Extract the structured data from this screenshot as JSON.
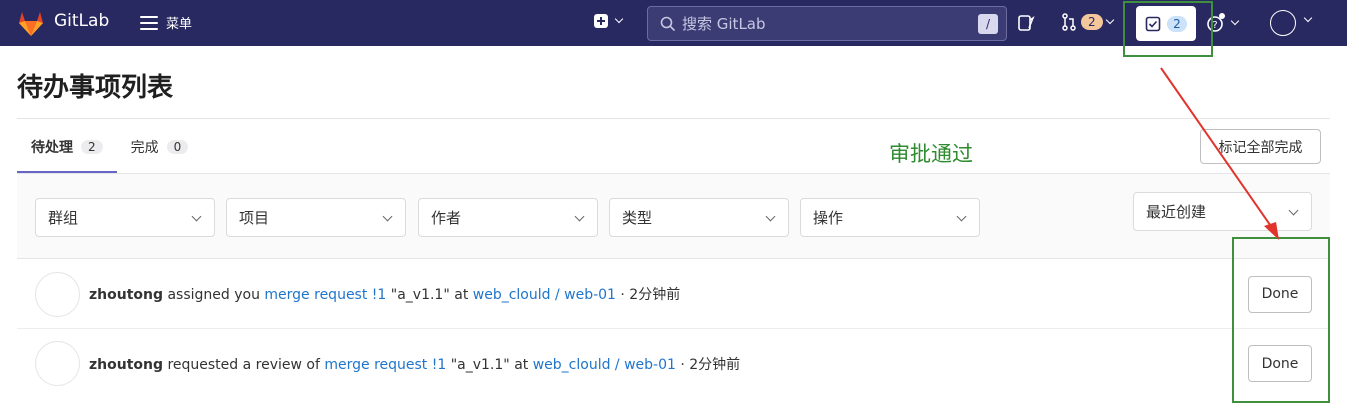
{
  "navbar": {
    "brand": "GitLab",
    "menu_label": "菜单",
    "search_placeholder": "搜索 GitLab",
    "search_shortcut": "/",
    "merge_requests_count": "2",
    "todos_count": "2"
  },
  "page": {
    "title": "待办事项列表",
    "tabs": [
      {
        "label": "待处理",
        "count": "2"
      },
      {
        "label": "完成",
        "count": "0"
      }
    ],
    "mark_all_done": "标记全部完成",
    "annotation": "审批通过"
  },
  "filters": {
    "group": "群组",
    "project": "项目",
    "author": "作者",
    "type": "类型",
    "action": "操作",
    "sort": "最近创建"
  },
  "todos": [
    {
      "author": "zhoutong",
      "action": "assigned you",
      "target": "merge request !1",
      "title": "\"a_v1.1\"",
      "at": "at",
      "project": "web_clould / web-01",
      "time": "· 2分钟前",
      "button": "Done"
    },
    {
      "author": "zhoutong",
      "action": "requested a review of",
      "target": "merge request !1",
      "title": "\"a_v1.1\"",
      "at": "at",
      "project": "web_clould / web-01",
      "time": "· 2分钟前",
      "button": "Done"
    }
  ],
  "colors": {
    "navbar": "#292961",
    "link": "#1f75cb",
    "annotation_green": "#3f8f3f",
    "annotation_arrow": "#e0342c"
  }
}
